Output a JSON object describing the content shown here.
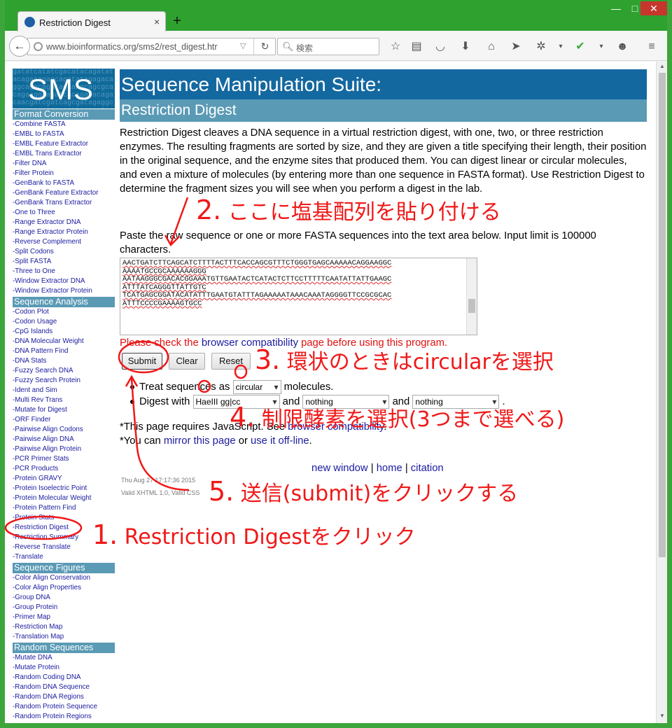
{
  "browser": {
    "tab_title": "Restriction Digest",
    "tab_close": "×",
    "new_tab": "+",
    "url": "www.bioinformatics.org/sms2/rest_digest.htr",
    "search_placeholder": "検索",
    "window_buttons": {
      "minimize": "—",
      "maximize": "□",
      "close": "✕"
    }
  },
  "sidebar": {
    "logo_text": "SMS",
    "logo_bg": "gatatcatatcgacatacagatatacagaaagagcagatatagagacaggcagacagatagaaagcagcgcacagaaggcagatcacagatacagacaacgatcgatcagcgatagaggcacagcagatcacagatacagatcgatcgatcagc",
    "sections": [
      {
        "heading": "Format Conversion",
        "items": [
          "-Combine FASTA",
          "-EMBL to FASTA",
          "-EMBL Feature Extractor",
          "-EMBL Trans Extractor",
          "-Filter DNA",
          "-Filter Protein",
          "-GenBank to FASTA",
          "-GenBank Feature Extractor",
          "-GenBank Trans Extractor",
          "-One to Three",
          "-Range Extractor DNA",
          "-Range Extractor Protein",
          "-Reverse Complement",
          "-Split Codons",
          "-Split FASTA",
          "-Three to One",
          "-Window Extractor DNA",
          "-Window Extractor Protein"
        ]
      },
      {
        "heading": "Sequence Analysis",
        "items": [
          "-Codon Plot",
          "-Codon Usage",
          "-CpG Islands",
          "-DNA Molecular Weight",
          "-DNA Pattern Find",
          "-DNA Stats",
          "-Fuzzy Search DNA",
          "-Fuzzy Search Protein",
          "-Ident and Sim",
          "-Multi Rev Trans",
          "-Mutate for Digest",
          "-ORF Finder",
          "-Pairwise Align Codons",
          "-Pairwise Align DNA",
          "-Pairwise Align Protein",
          "-PCR Primer Stats",
          "-PCR Products",
          "-Protein GRAVY",
          "-Protein Isoelectric Point",
          "-Protein Molecular Weight",
          "-Protein Pattern Find",
          "-Protein Stats",
          "-Restriction Digest",
          "-Restriction Summary",
          "-Reverse Translate",
          "-Translate"
        ]
      },
      {
        "heading": "Sequence Figures",
        "items": [
          "-Color Align Conservation",
          "-Color Align Properties",
          "-Group DNA",
          "-Group Protein",
          "-Primer Map",
          "-Restriction Map",
          "-Translation Map"
        ]
      },
      {
        "heading": "Random Sequences",
        "items": [
          "-Mutate DNA",
          "-Mutate Protein",
          "-Random Coding DNA",
          "-Random DNA Sequence",
          "-Random DNA Regions",
          "-Random Protein Sequence",
          "-Random Protein Regions"
        ]
      }
    ]
  },
  "main": {
    "title": "Sequence Manipulation Suite:",
    "subtitle": "Restriction Digest",
    "intro": "Restriction Digest cleaves a DNA sequence in a virtual restriction digest, with one, two, or three restriction enzymes. The resulting fragments are sorted by size, and they are given a title specifying their length, their position in the original sequence, and the enzyme sites that produced them. You can digest linear or circular molecules, and even a mixture of molecules (by entering more than one sequence in FASTA format). Use Restriction Digest to determine the fragment sizes you will see when you perform a digest in the lab.",
    "paste_label": "Paste the raw sequence or one or more FASTA sequences into the text area below. Input limit is 100000 characters.",
    "sequence": "AACTGATCTTCAGCATCTTTTACTTTCACCAGCGTTTCTGGGTGAGCAAAAACAGGAAGGC\nAAAATGCCGCAAAAAAGGG\nAATAAGGGCGACACGGAAATGTTGAATACTCATACTCTTCCTTTTTCAATATTATTGAAGC\nATTTATCAGGGTTATTGTC\nTCATGAGCGGATACATATTTGAATGTATTTAGAAAAATAAACAAATAGGGGTTCCGCGCAC\nATTTCCCCGAAAAGTGCC",
    "compat_pre": "Please check the ",
    "compat_link": "browser compatibility",
    "compat_post": " page before using this program.",
    "buttons": {
      "submit": "Submit",
      "clear": "Clear",
      "reset": "Reset"
    },
    "treat_pre": "Treat sequences as",
    "treat_value": "circular",
    "treat_post": "molecules.",
    "digest_pre": "Digest with",
    "enzyme1": "HaeIII gg|cc",
    "and1": "and",
    "enzyme2": "nothing",
    "and2": "and",
    "enzyme3": "nothing",
    "period": ".",
    "js_line_pre": "*This page requires JavaScript. See ",
    "js_line_link": "browser compatibility",
    "js_line_post": ".",
    "mirror_pre": "*You can ",
    "mirror_link": "mirror this page",
    "mirror_mid": " or ",
    "offline_link": "use it off-line",
    "mirror_post": ".",
    "footer": {
      "new_window": "new window",
      "sep1": " | ",
      "home": "home",
      "sep2": " | ",
      "citation": "citation"
    },
    "date": "Thu Aug 27 17:17:36 2015",
    "valid": "Valid XHTML 1.0, Valid CSS"
  },
  "annotations": {
    "a1_num": "1.",
    "a1_text": " Restriction Digestをクリック",
    "a2_num": "2.",
    "a2_text": " ここに塩基配列を貼り付ける",
    "a3_num": "3.",
    "a3_text": " 環状のときはcircularを選択",
    "a4_num": "4.",
    "a4_text": " 制限酵素を選択(3つまで選べる)",
    "a5_num": "5.",
    "a5_text": " 送信(submit)をクリックする",
    "color": "#f01818"
  }
}
